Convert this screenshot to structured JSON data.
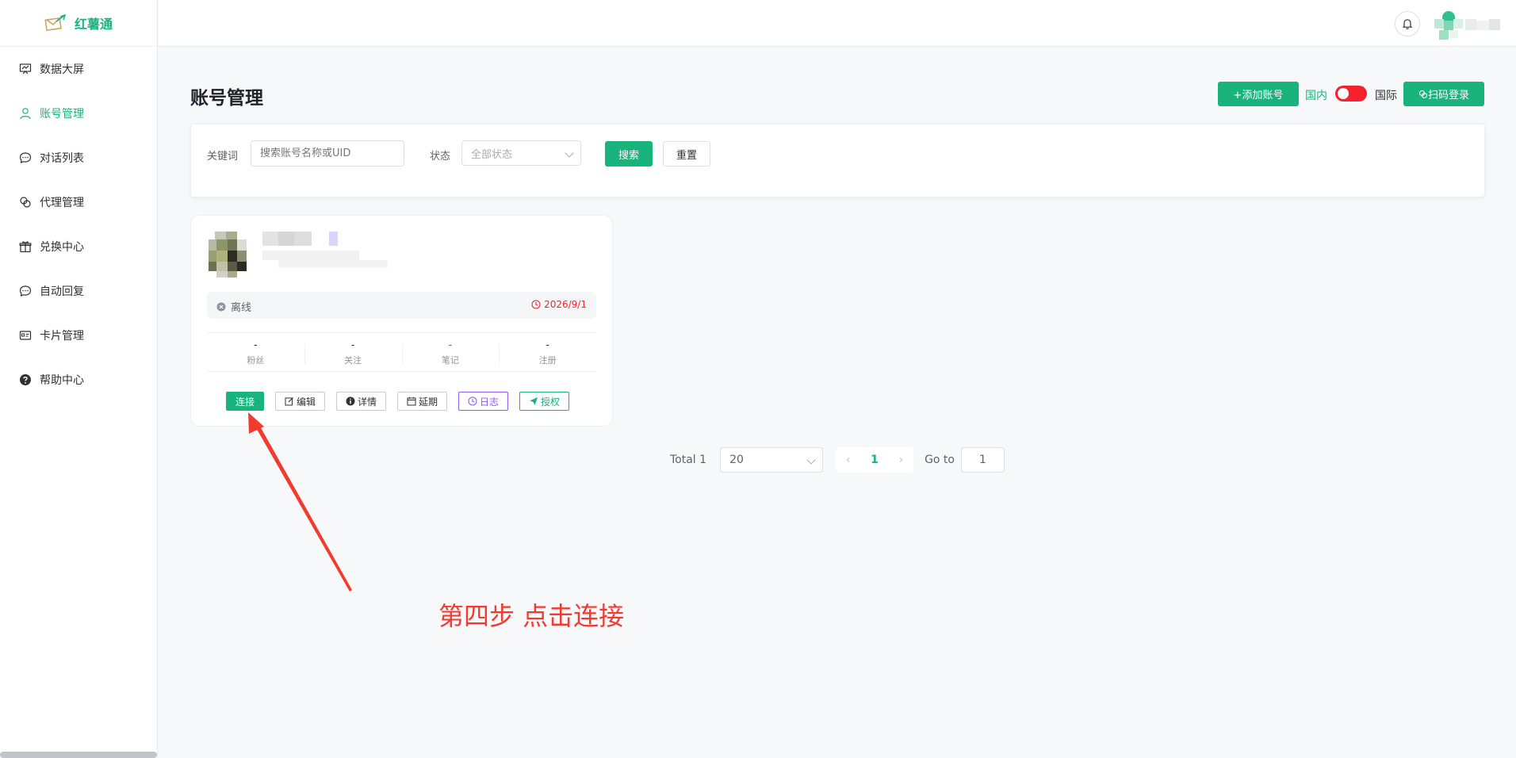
{
  "app": {
    "name": "红薯通",
    "brand_color": "#18b47c",
    "alert_color": "#f5222d"
  },
  "sidebar": {
    "items": [
      {
        "label": "数据大屏",
        "icon": "dashboard-icon"
      },
      {
        "label": "账号管理",
        "icon": "user-icon",
        "active": true
      },
      {
        "label": "对话列表",
        "icon": "chat-icon"
      },
      {
        "label": "代理管理",
        "icon": "link-icon"
      },
      {
        "label": "兑换中心",
        "icon": "gift-icon"
      },
      {
        "label": "自动回复",
        "icon": "reply-icon"
      },
      {
        "label": "卡片管理",
        "icon": "card-icon"
      },
      {
        "label": "帮助中心",
        "icon": "help-icon"
      }
    ]
  },
  "header": {
    "bell_icon": "bell-icon"
  },
  "page": {
    "title": "账号管理",
    "add_button": "+添加账号",
    "region_domestic": "国内",
    "region_international": "国际",
    "scan_button": "扫码登录"
  },
  "filter": {
    "keyword_label": "关键词",
    "keyword_placeholder": "搜索账号名称或UID",
    "status_label": "状态",
    "status_value": "全部状态",
    "search_button": "搜索",
    "reset_button": "重置"
  },
  "account_card": {
    "status": "离线",
    "expire_date": "2026/9/1",
    "stats": [
      {
        "value": "-",
        "label": "粉丝"
      },
      {
        "value": "-",
        "label": "关注"
      },
      {
        "value": "-",
        "label": "笔记"
      },
      {
        "value": "-",
        "label": "注册"
      }
    ],
    "actions": {
      "connect": "连接",
      "edit": "编辑",
      "detail": "详情",
      "extend": "延期",
      "log": "日志",
      "authorize": "授权"
    }
  },
  "pagination": {
    "total": "Total 1",
    "page_size": "20",
    "current_page": "1",
    "goto_label": "Go to",
    "goto_value": "1"
  },
  "annotation": {
    "text": "第四步 点击连接",
    "color": "#f23a2f"
  }
}
